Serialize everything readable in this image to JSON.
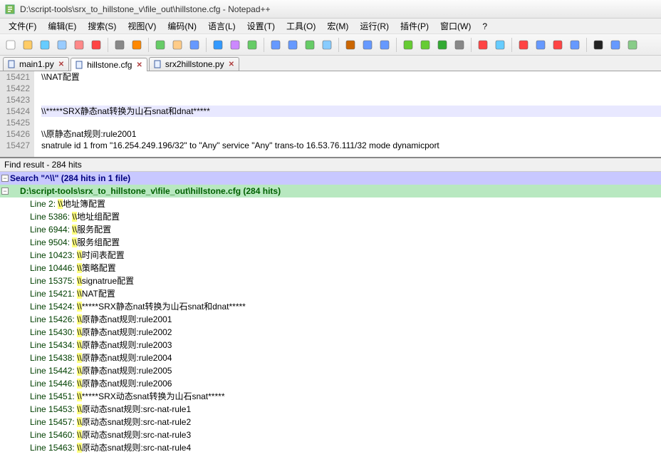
{
  "window": {
    "title": "D:\\script-tools\\srx_to_hillstone_v\\file_out\\hillstone.cfg - Notepad++"
  },
  "menu": [
    "文件(F)",
    "编辑(E)",
    "搜索(S)",
    "视图(V)",
    "编码(N)",
    "语言(L)",
    "设置(T)",
    "工具(O)",
    "宏(M)",
    "运行(R)",
    "插件(P)",
    "窗口(W)",
    "?"
  ],
  "tabs": [
    {
      "label": "main1.py",
      "active": false
    },
    {
      "label": "hillstone.cfg",
      "active": true
    },
    {
      "label": "srx2hillstone.py",
      "active": false
    }
  ],
  "editor": {
    "lines": [
      {
        "num": "15421",
        "text": "\\\\NAT配置",
        "hl": false
      },
      {
        "num": "15422",
        "text": "",
        "hl": false
      },
      {
        "num": "15423",
        "text": "",
        "hl": false
      },
      {
        "num": "15424",
        "text": "\\\\*****SRX静态nat转换为山石snat和dnat*****",
        "hl": true
      },
      {
        "num": "15425",
        "text": "",
        "hl": false
      },
      {
        "num": "15426",
        "text": "\\\\原静态nat规则:rule2001",
        "hl": false
      },
      {
        "num": "15427",
        "text": "snatrule id 1 from \"16.254.249.196/32\" to \"Any\" service \"Any\" trans-to 16.53.76.111/32 mode dynamicport",
        "hl": false
      }
    ]
  },
  "find": {
    "header": "Find result - 284 hits",
    "search": "Search \"^\\\\\" (284 hits in 1 file)",
    "file": "D:\\script-tools\\srx_to_hillstone_v\\file_out\\hillstone.cfg (284 hits)",
    "hits": [
      {
        "label": "Line 2:",
        "pre": "\\\\",
        "post": "地址簿配置"
      },
      {
        "label": "Line 5386:",
        "pre": "\\\\",
        "post": "地址组配置"
      },
      {
        "label": "Line 6944:",
        "pre": "\\\\",
        "post": "服务配置"
      },
      {
        "label": "Line 9504:",
        "pre": "\\\\",
        "post": "服务组配置"
      },
      {
        "label": "Line 10423:",
        "pre": "\\\\",
        "post": "时间表配置"
      },
      {
        "label": "Line 10446:",
        "pre": "\\\\",
        "post": "策略配置"
      },
      {
        "label": "Line 15375:",
        "pre": "\\\\",
        "post": "signatrue配置"
      },
      {
        "label": "Line 15421:",
        "pre": "\\\\",
        "post": "NAT配置"
      },
      {
        "label": "Line 15424:",
        "pre": "\\\\",
        "post": "*****SRX静态nat转换为山石snat和dnat*****"
      },
      {
        "label": "Line 15426:",
        "pre": "\\\\",
        "post": "原静态nat规则:rule2001"
      },
      {
        "label": "Line 15430:",
        "pre": "\\\\",
        "post": "原静态nat规则:rule2002"
      },
      {
        "label": "Line 15434:",
        "pre": "\\\\",
        "post": "原静态nat规则:rule2003"
      },
      {
        "label": "Line 15438:",
        "pre": "\\\\",
        "post": "原静态nat规则:rule2004"
      },
      {
        "label": "Line 15442:",
        "pre": "\\\\",
        "post": "原静态nat规则:rule2005"
      },
      {
        "label": "Line 15446:",
        "pre": "\\\\",
        "post": "原静态nat规则:rule2006"
      },
      {
        "label": "Line 15451:",
        "pre": "\\\\",
        "post": "*****SRX动态snat转换为山石snat*****"
      },
      {
        "label": "Line 15453:",
        "pre": "\\\\",
        "post": "原动态snat规则:src-nat-rule1"
      },
      {
        "label": "Line 15457:",
        "pre": "\\\\",
        "post": "原动态snat规则:src-nat-rule2"
      },
      {
        "label": "Line 15460:",
        "pre": "\\\\",
        "post": "原动态snat规则:src-nat-rule3"
      },
      {
        "label": "Line 15463:",
        "pre": "\\\\",
        "post": "原动态snat规则:src-nat-rule4"
      }
    ]
  },
  "toolbar_icons": [
    "new",
    "open",
    "save",
    "save-all",
    "close",
    "close-all",
    "print",
    "cut",
    "copy",
    "paste",
    "undo",
    "redo",
    "find",
    "replace",
    "zoom-in",
    "zoom-out",
    "sync",
    "wrap",
    "chars",
    "indent",
    "outdent",
    "fold",
    "unfold",
    "comment",
    "bookmark",
    "func",
    "run",
    "record",
    "play",
    "stop",
    "play2",
    "terminal",
    "keyboard",
    "spell"
  ]
}
